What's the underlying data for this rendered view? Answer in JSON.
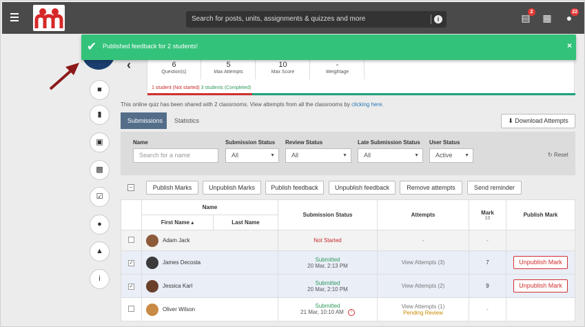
{
  "topbar": {
    "search_placeholder": "Search for posts, units, assignments & quizzes and more",
    "notifications_badge": "2",
    "messages_badge": "22"
  },
  "toast": {
    "message": "Published feedback for 2 students!",
    "close": "×"
  },
  "stats": [
    {
      "value": "6",
      "label": "Question(s)"
    },
    {
      "value": "5",
      "label": "Max Attempts"
    },
    {
      "value": "10",
      "label": "Max Score"
    },
    {
      "value": "-",
      "label": "Weightage"
    }
  ],
  "progress": {
    "not_started": "1 student (Not started)",
    "completed": "3 students (Completed)"
  },
  "shared_note": {
    "text": "This online quiz has been shared with 2 classrooms. View attempts from all the classrooms by ",
    "link": "clicking here."
  },
  "tabs": {
    "submissions": "Submissions",
    "statistics": "Statistics"
  },
  "download_label": "Download Attempts",
  "filters": {
    "name_label": "Name",
    "name_placeholder": "Search for a name",
    "submission_label": "Submission Status",
    "submission_value": "All",
    "review_label": "Review Status",
    "review_value": "All",
    "late_label": "Late Submission Status",
    "late_value": "All",
    "user_label": "User Status",
    "user_value": "Active",
    "reset": "Reset"
  },
  "actions": [
    "Publish Marks",
    "Unpublish Marks",
    "Publish feedback",
    "Unpublish feedback",
    "Remove attempts",
    "Send reminder"
  ],
  "table": {
    "h_name": "Name",
    "h_first": "First Name ▴",
    "h_last": "Last Name",
    "h_status": "Submission Status",
    "h_attempts": "Attempts",
    "h_mark": "Mark",
    "h_mark_max": "10",
    "h_publish": "Publish Mark",
    "rows": [
      {
        "name": "Adam Jack",
        "status": "Not Started",
        "date": "",
        "attempts": "-",
        "pending": "",
        "mark": "-",
        "publish": ""
      },
      {
        "name": "James Decosta",
        "status": "Submitted",
        "date": "20 Mar, 2:13 PM",
        "attempts": "View Attempts (3)",
        "pending": "",
        "mark": "7",
        "publish": "Unpublish Mark"
      },
      {
        "name": "Jessica Karl",
        "status": "Submitted",
        "date": "20 Mar, 2:10 PM",
        "attempts": "View Attempts (2)",
        "pending": "",
        "mark": "9",
        "publish": "Unpublish Mark"
      },
      {
        "name": "Oliver Wilson",
        "status": "Submitted",
        "date": "21 Mar, 10:10 AM",
        "attempts": "View Attempts (1)",
        "pending": "Pending Review",
        "mark": "-",
        "publish": ""
      }
    ]
  },
  "colors": {
    "toast": "#33c27a",
    "topbar": "#4a4a4a",
    "tab_active": "#546e8a",
    "danger": "#d32f2f",
    "success": "#2e9a5d"
  }
}
